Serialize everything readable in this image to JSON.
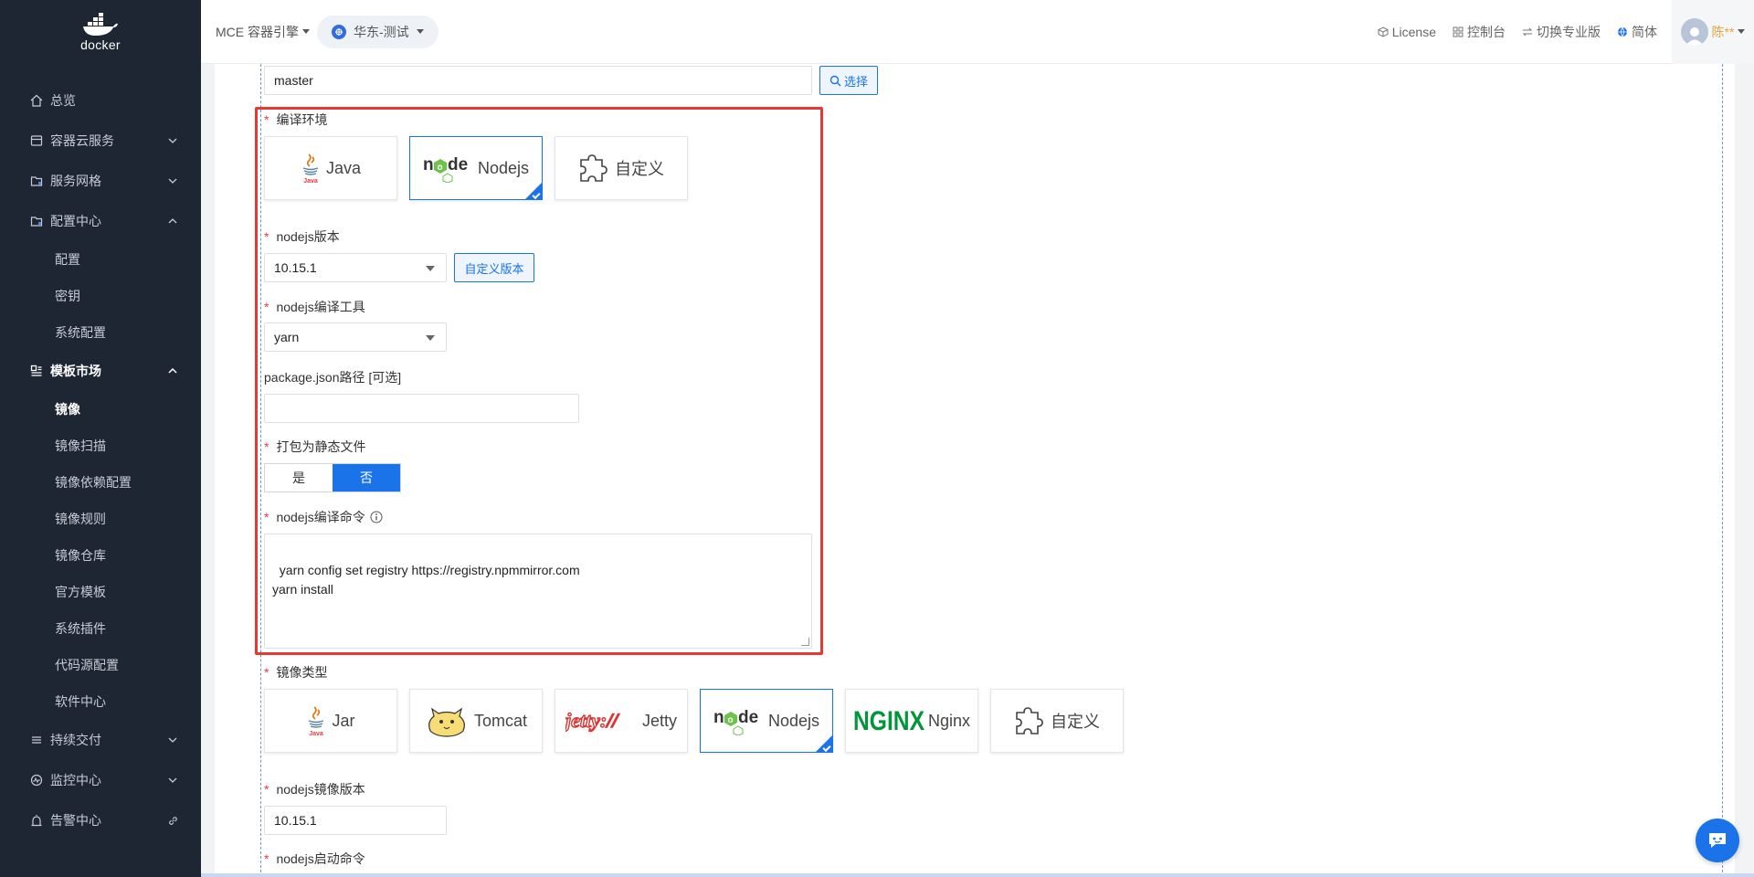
{
  "brand": {
    "name": "docker"
  },
  "sidebar": {
    "items": [
      {
        "label": "总览",
        "icon": "home-icon",
        "chevron": "none"
      },
      {
        "label": "容器云服务",
        "icon": "box-icon",
        "chevron": "down"
      },
      {
        "label": "服务网格",
        "icon": "folder-icon",
        "chevron": "down"
      },
      {
        "label": "配置中心",
        "icon": "config-icon",
        "chevron": "up"
      }
    ],
    "config_children": [
      "配置",
      "密钥",
      "系统配置"
    ],
    "template_market": {
      "label": "模板市场",
      "icon": "template-icon",
      "chevron": "up"
    },
    "template_children": [
      "镜像",
      "镜像扫描",
      "镜像依赖配置",
      "镜像规则",
      "镜像仓库",
      "官方模板",
      "系统插件",
      "代码源配置",
      "软件中心"
    ],
    "active_child": "镜像",
    "bottom_items": [
      {
        "label": "持续交付",
        "icon": "delivery-icon",
        "chevron": "down"
      },
      {
        "label": "监控中心",
        "icon": "monitor-icon",
        "chevron": "down"
      },
      {
        "label": "告警中心",
        "icon": "alarm-icon",
        "chevron": "link"
      }
    ]
  },
  "header": {
    "engine": "MCE 容器引擎",
    "region": "华东-测试",
    "links": [
      {
        "label": "License",
        "icon": "cube-icon"
      },
      {
        "label": "控制台",
        "icon": "grid-icon"
      },
      {
        "label": "切换专业版",
        "icon": "swap-icon"
      },
      {
        "label": "简体",
        "icon": "globe-icon"
      }
    ],
    "user": "陈**"
  },
  "form": {
    "branch_value": "master",
    "select_button": "选择",
    "build_env_label": "编译环境",
    "build_env_options": [
      "Java",
      "Nodejs",
      "自定义"
    ],
    "build_env_selected": "Nodejs",
    "nodejs_version_label": "nodejs版本",
    "nodejs_version_value": "10.15.1",
    "custom_version_button": "自定义版本",
    "build_tool_label": "nodejs编译工具",
    "build_tool_value": "yarn",
    "package_json_label": "package.json路径 [可选]",
    "package_json_value": "",
    "static_label": "打包为静态文件",
    "static_yes": "是",
    "static_no": "否",
    "static_selected": "否",
    "build_cmd_label": "nodejs编译命令",
    "build_cmd_value": "yarn config set registry https://registry.npmmirror.com\nyarn install",
    "image_type_label": "镜像类型",
    "image_type_options": [
      "Jar",
      "Tomcat",
      "Jetty",
      "Nodejs",
      "Nginx",
      "自定义"
    ],
    "image_type_selected": "Nodejs",
    "image_version_label": "nodejs镜像版本",
    "image_version_value": "10.15.1",
    "start_cmd_label": "nodejs启动命令"
  },
  "colors": {
    "accent": "#1a73e8",
    "sidebar_bg": "#1f2633",
    "highlight_box": "#e53935",
    "required": "#f23c3c"
  }
}
